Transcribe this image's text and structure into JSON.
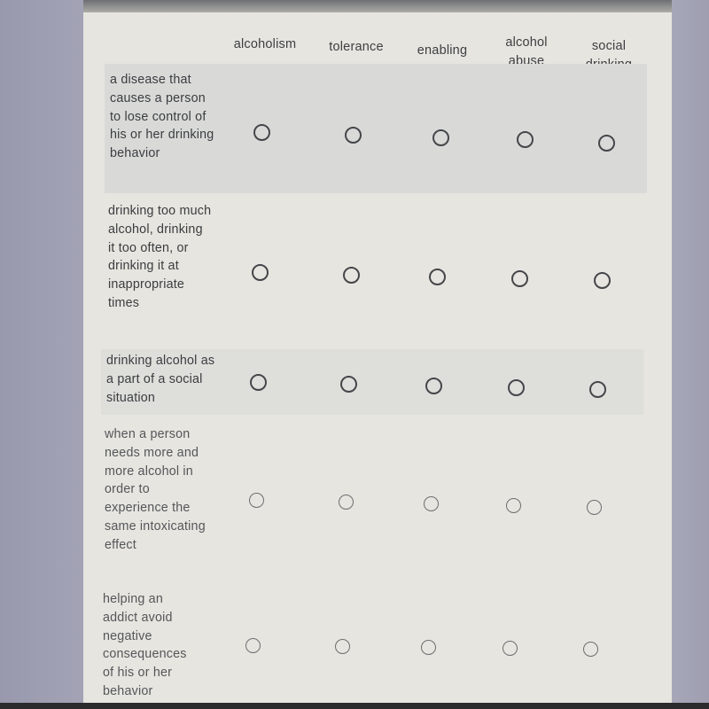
{
  "columns": [
    "alcoholism",
    "tolerance",
    "enabling",
    "alcohol abuse",
    "social drinking"
  ],
  "rows": [
    {
      "label": "a disease that causes a person to lose control of his or her drinking behavior",
      "selected": null
    },
    {
      "label": "drinking too much alcohol, drinking it too often, or drinking it at inappropriate times",
      "selected": null
    },
    {
      "label": "drinking alcohol as a part of a social situation",
      "selected": null
    },
    {
      "label": "when a person needs more and more alcohol in order to experience the same intoxicating effect",
      "selected": null
    },
    {
      "label": "helping an addict avoid negative consequences of his or her behavior",
      "selected": null
    }
  ]
}
